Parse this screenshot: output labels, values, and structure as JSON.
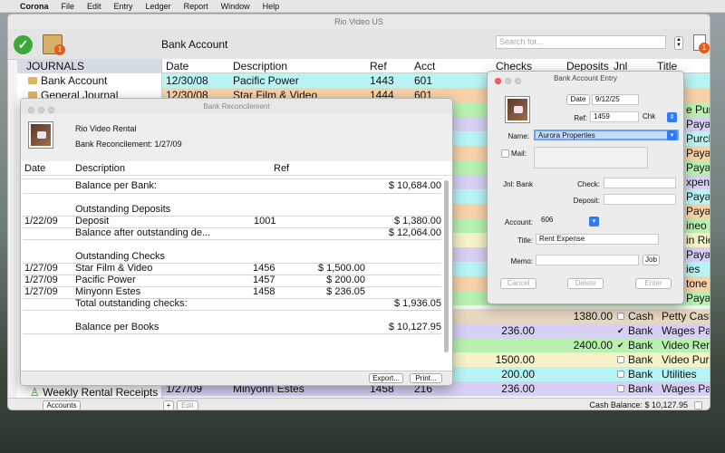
{
  "menubar": {
    "apple": "",
    "app": "Corona",
    "items": [
      "File",
      "Edit",
      "Entry",
      "Ledger",
      "Report",
      "Window",
      "Help"
    ]
  },
  "main": {
    "window_title": "Rio Video US",
    "page_title": "Bank Account",
    "search_placeholder": "Search for...",
    "badge_books": "1",
    "badge_reports": "1",
    "sidebar": {
      "header": "JOURNALS",
      "items": [
        "Bank Account",
        "General Journal"
      ],
      "letter_n": "N",
      "bottom_item": "Weekly Rental Receipts"
    },
    "columns": {
      "date": "Date",
      "description": "Description",
      "ref": "Ref",
      "acct": "Acct",
      "checks": "Checks",
      "deposits": "Deposits",
      "jnl": "Jnl",
      "title": "Title"
    },
    "rows": [
      {
        "date": "12/30/08",
        "description": "Pacific Power",
        "ref": "1443",
        "acct": "601",
        "checks": "",
        "deposits": "",
        "jnl": "",
        "title": ""
      },
      {
        "date": "12/30/08",
        "description": "Star Film & Video",
        "ref": "1444",
        "acct": "601",
        "checks": "",
        "deposits": "",
        "jnl": "",
        "title": ""
      }
    ],
    "title_fragments": [
      "e Purch",
      "Paya",
      "Purch",
      "Paya",
      "Paya",
      "xpense",
      "Paya",
      "Paya",
      "ineo",
      "in Rio,",
      "Paya",
      "ies",
      "tone",
      "Paya"
    ],
    "lower_rows": [
      {
        "checks": "",
        "deposits": "1380.00",
        "jnl": "Cash",
        "title": "Petty Cash",
        "checked": false
      },
      {
        "checks": "236.00",
        "deposits": "",
        "jnl": "Bank",
        "title": "Wages Paya",
        "checked": true
      },
      {
        "checks": "",
        "deposits": "2400.00",
        "jnl": "Bank",
        "title": "Video Renta",
        "checked": true
      },
      {
        "checks": "1500.00",
        "deposits": "",
        "jnl": "Bank",
        "title": "Video Purch",
        "checked": false
      },
      {
        "checks": "200.00",
        "deposits": "",
        "jnl": "Bank",
        "title": "Utilities",
        "checked": false
      },
      {
        "date": "1/27/09",
        "description": "Minyonn Estes",
        "ref": "1458",
        "acct": "216",
        "checks": "236.00",
        "deposits": "",
        "jnl": "Bank",
        "title": "Wages Paya",
        "checked": false
      }
    ],
    "bottom": {
      "accounts_button": "Accounts",
      "add_button": "+",
      "edit_button": "Edit",
      "cash_balance": "Cash Balance: $ 10,127.95"
    }
  },
  "recon": {
    "title": "Bank Reconcilement",
    "company": "Rio Video Rental",
    "subtitle": "Bank Reconcilement:  1/27/09",
    "columns": {
      "date": "Date",
      "description": "Description",
      "ref": "Ref"
    },
    "balance_per_bank": {
      "label": "Balance per Bank:",
      "amount": "$ 10,684.00"
    },
    "outstanding_deposits_label": "Outstanding Deposits",
    "deposit": {
      "date": "1/22/09",
      "description": "Deposit",
      "ref": "1001",
      "amount": "$ 1,380.00"
    },
    "balance_after": {
      "label": "Balance after outstanding de...",
      "amount": "$ 12,064.00"
    },
    "outstanding_checks_label": "Outstanding Checks",
    "checks": [
      {
        "date": "1/27/09",
        "description": "Star Film & Video",
        "ref": "1456",
        "amount": "$ 1,500.00"
      },
      {
        "date": "1/27/09",
        "description": "Pacific Power",
        "ref": "1457",
        "amount": "$ 200.00"
      },
      {
        "date": "1/27/09",
        "description": "Minyonn Estes",
        "ref": "1458",
        "amount": "$ 236.05"
      }
    ],
    "total_checks": {
      "label": "Total outstanding checks:",
      "amount": "$ 1,936.05"
    },
    "balance_per_books": {
      "label": "Balance per Books",
      "amount": "$ 10,127.95"
    },
    "export_button": "Export...",
    "print_button": "Print..."
  },
  "entry": {
    "title": "Bank Account Entry",
    "date_button": "Date",
    "date_value": "9/12/25",
    "ref_label": "Ref:",
    "ref_value": "1459",
    "ref_type": "Chk",
    "name_label": "Name:",
    "name_value": "Aurora Properties",
    "mail_label": "Mail:",
    "jnl_label": "Jnl: Bank",
    "check_label": "Check:",
    "deposit_label": "Deposit:",
    "account_label": "Account:",
    "account_value": "606",
    "title_label": "Title:",
    "title_value": "Rent Expense",
    "memo_label": "Memo:",
    "job_button": "Job",
    "cancel_button": "Cancel",
    "delete_button": "Delete",
    "enter_button": "Enter"
  },
  "colors": {
    "cyan": "#b8f4f4",
    "peach": "#f8d1a8",
    "green": "#b8f0b0",
    "purple": "#d8d0f4",
    "yellow": "#f6f2c8",
    "tan": "#e6d7bf",
    "accent": "#2f7bf5"
  }
}
